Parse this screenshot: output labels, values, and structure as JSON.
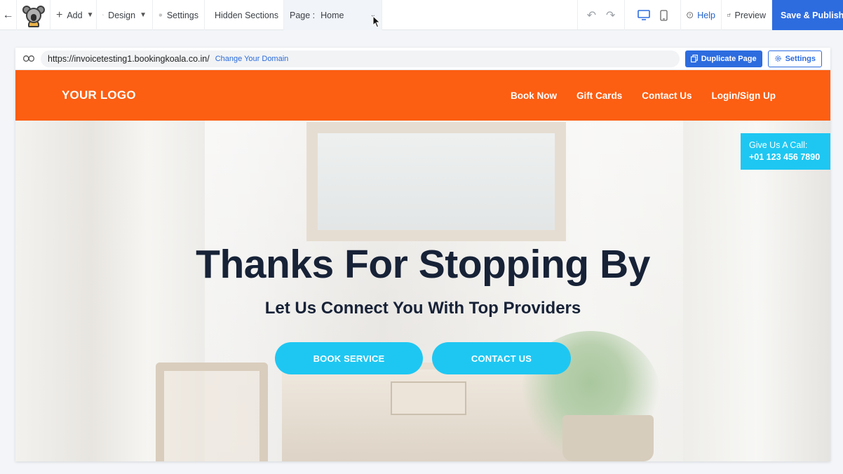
{
  "toolbar": {
    "add_label": "Add",
    "design_label": "Design",
    "settings_label": "Settings",
    "hidden_sections_label": "Hidden Sections",
    "page_prefix": "Page :",
    "page_value": "Home",
    "help_label": "Help",
    "preview_label": "Preview",
    "publish_label": "Save & Publish"
  },
  "urlbar": {
    "url": "https://invoicetesting1.bookingkoala.co.in/",
    "change_domain": "Change Your Domain",
    "duplicate_label": "Duplicate Page",
    "settings_label": "Settings"
  },
  "site": {
    "logo": "YOUR LOGO",
    "nav": [
      "Book Now",
      "Gift Cards",
      "Contact Us",
      "Login/Sign Up"
    ],
    "call_label": "Give Us A Call:",
    "call_number": "+01 123 456 7890",
    "hero_title": "Thanks For Stopping By",
    "hero_subtitle": "Let Us Connect You With Top Providers",
    "book_button": "BOOK SERVICE",
    "contact_button": "CONTACT US"
  },
  "colors": {
    "accent": "#2d6cdf",
    "header_orange": "#fc5e12",
    "cta_cyan": "#1ec7f2",
    "heading_navy": "#172237"
  },
  "icons": [
    "back-arrow-icon",
    "koala-logo",
    "plus-icon",
    "chevron-down-icon",
    "design-tools-icon",
    "gear-icon",
    "eye-slash-icon",
    "undo-icon",
    "redo-icon",
    "desktop-icon",
    "mobile-icon",
    "help-circle-icon",
    "external-link-icon",
    "upload-icon",
    "link-icon",
    "copy-icon"
  ]
}
